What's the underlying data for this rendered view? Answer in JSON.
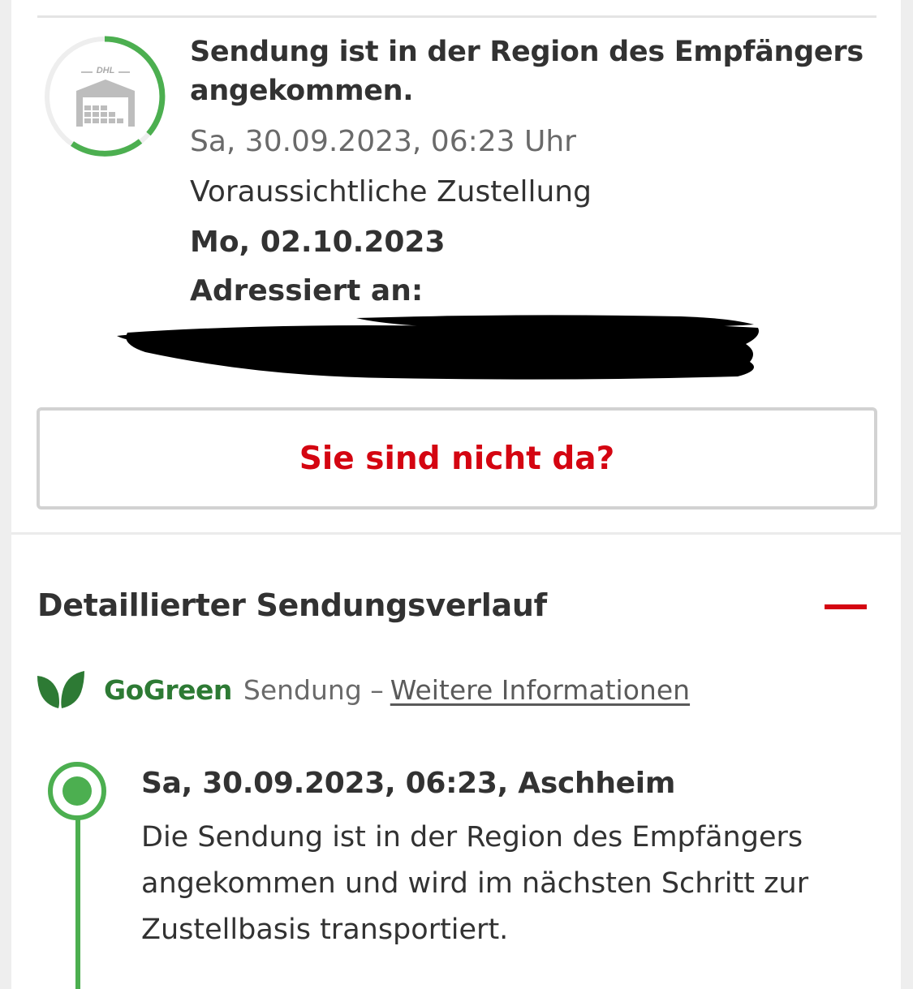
{
  "status": {
    "title": "Sendung ist in der Region des Empfängers angekommen.",
    "timestamp": "Sa, 30.09.2023, 06:23 Uhr",
    "eta_label": "Voraussichtliche Zustellung",
    "eta_date": "Mo, 02.10.2023",
    "address_label": "Adressiert an:",
    "icon": "dhl-warehouse-icon",
    "progress": 0.6
  },
  "actions": {
    "not_home_label": "Sie sind nicht da?"
  },
  "history": {
    "title": "Detaillierter Sendungsverlauf",
    "collapse_icon": "minus-icon",
    "gogreen": {
      "brand": "GoGreen",
      "suffix": "Sendung –",
      "link": "Weitere Informationen",
      "icon": "leaf-icon"
    },
    "events": [
      {
        "title": "Sa, 30.09.2023, 06:23, Aschheim",
        "description": "Die Sendung ist in der Region des Empfängers angekommen und wird im nächsten Schritt zur Zustellbasis transportiert."
      }
    ]
  },
  "colors": {
    "accent_red": "#d40511",
    "progress_green": "#4caf50",
    "gogreen_green": "#2d7a34",
    "text_dark": "#323232",
    "text_muted": "#6a6a6a"
  }
}
